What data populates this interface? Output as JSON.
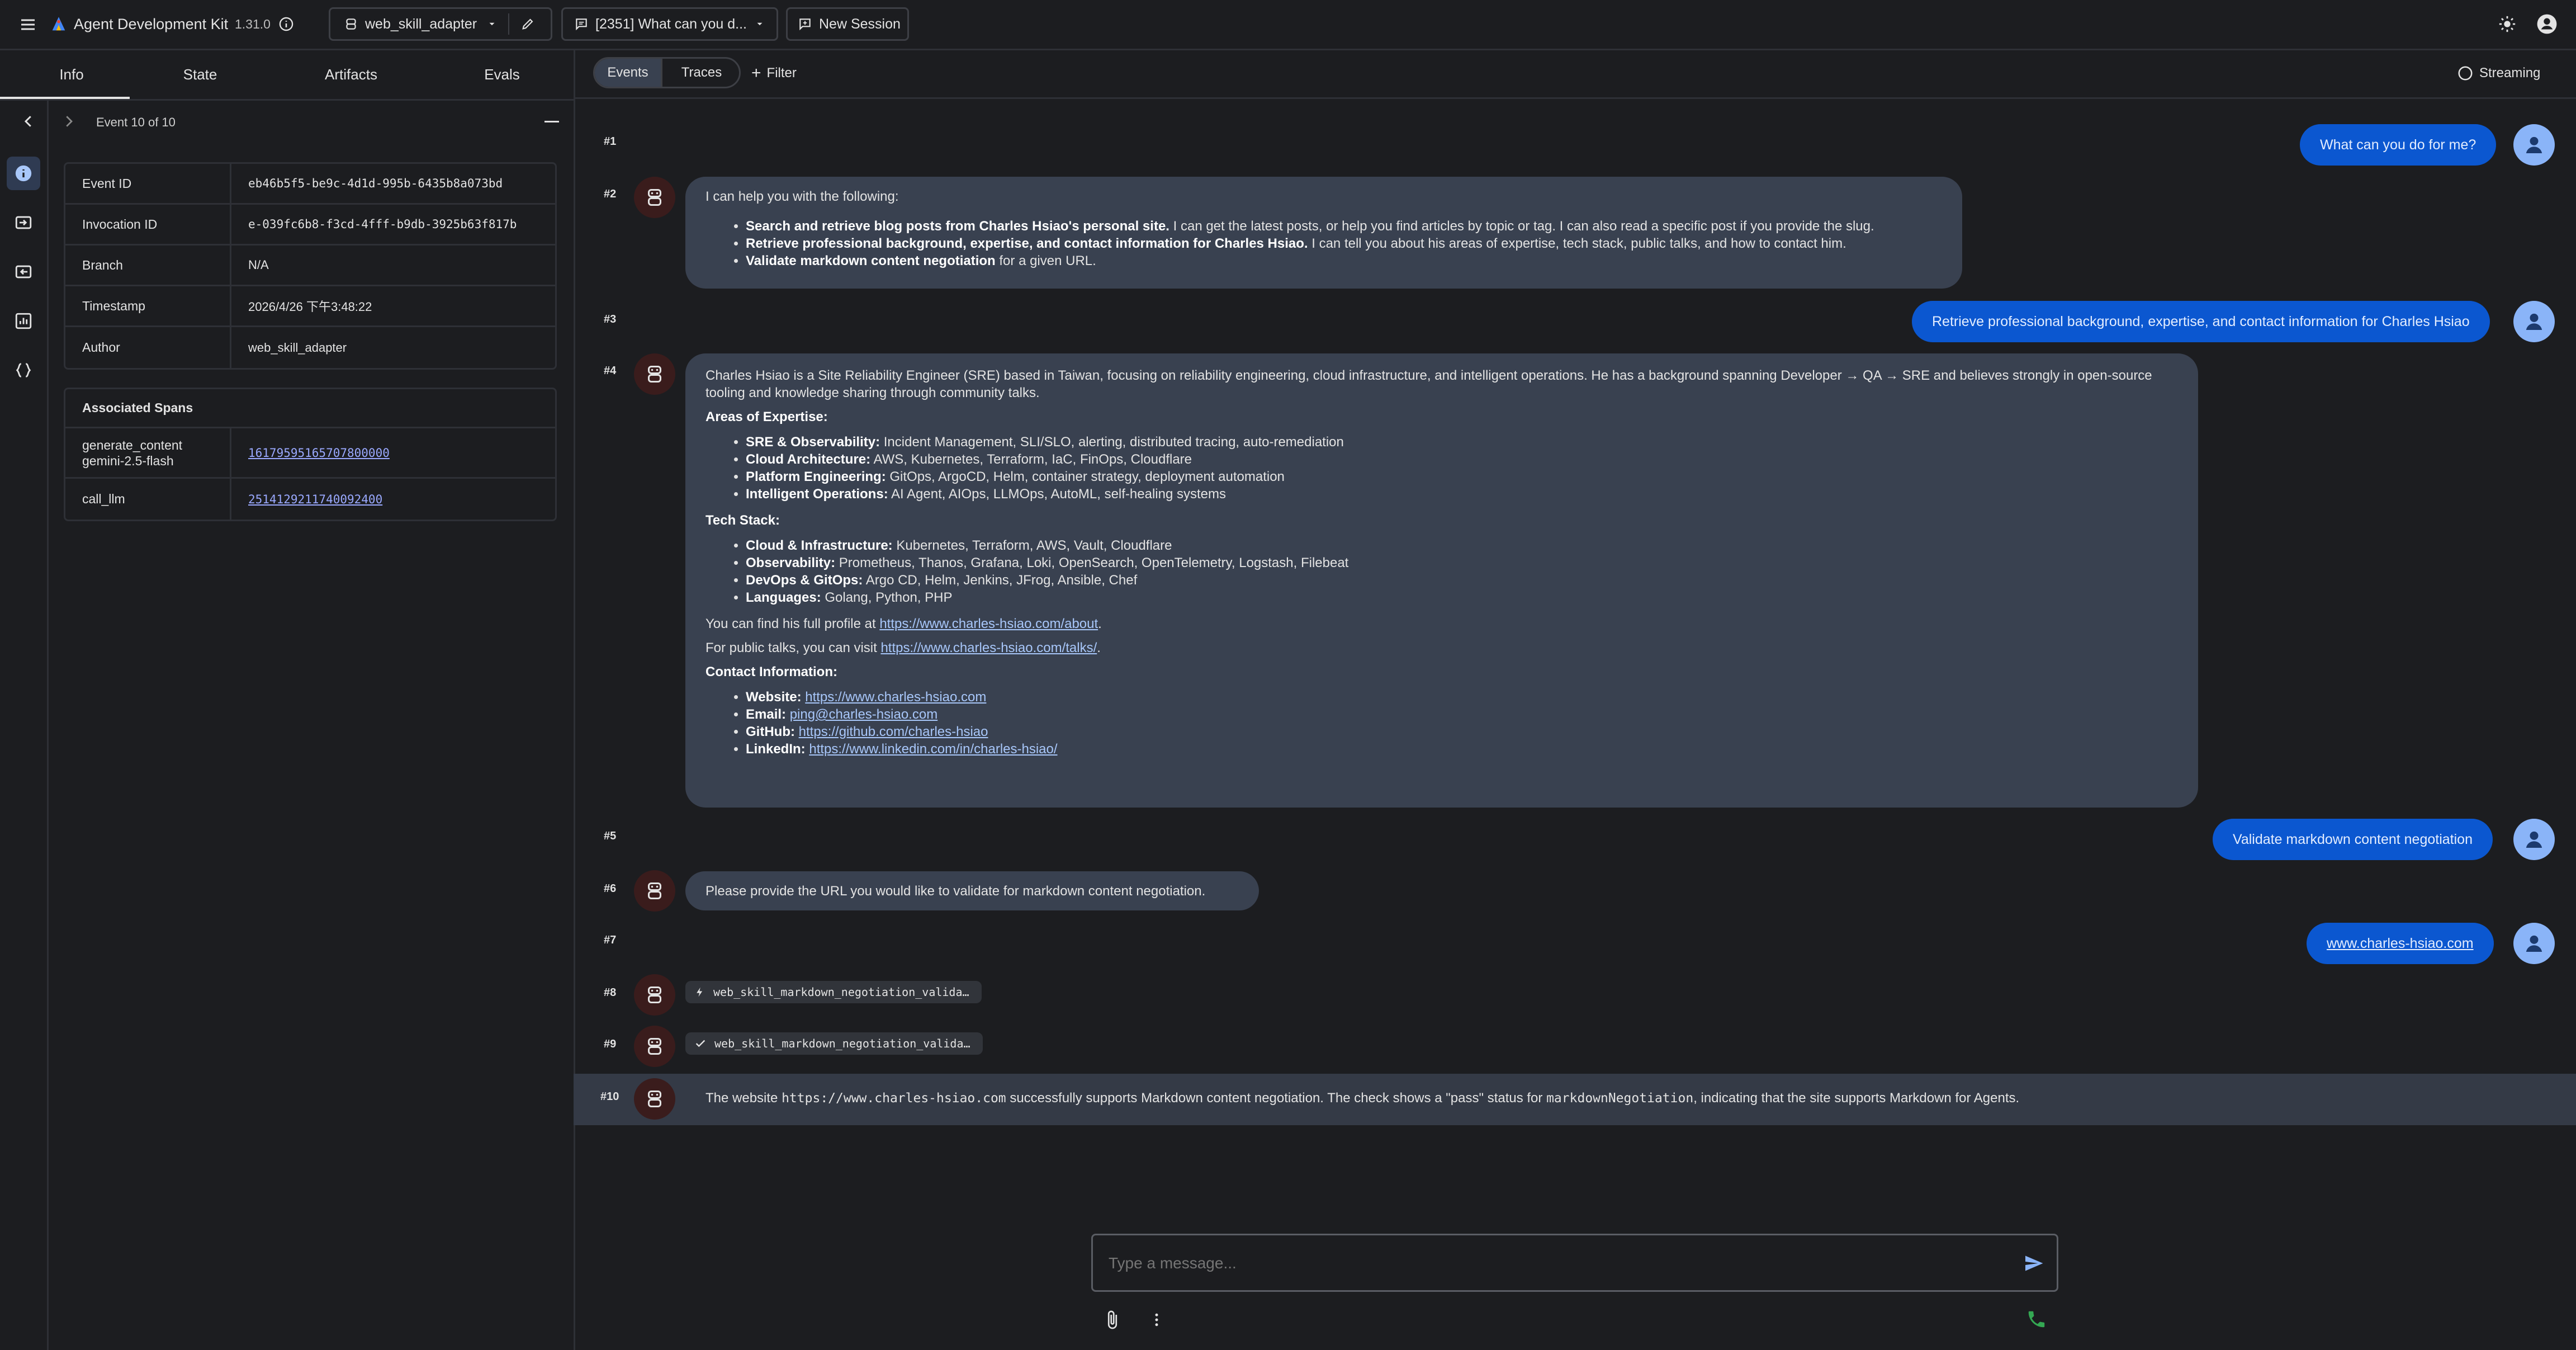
{
  "app": {
    "title": "Agent Development Kit",
    "version": "1.31.0"
  },
  "topbar": {
    "agent": "web_skill_adapter",
    "session": "[2351] What can you d...",
    "new_session": "New Session"
  },
  "left": {
    "tabs": [
      "Info",
      "State",
      "Artifacts",
      "Evals"
    ],
    "event_nav": "Event 10 of 10",
    "details": [
      {
        "k": "Event ID",
        "v": "eb46b5f5-be9c-4d1d-995b-6435b8a073bd"
      },
      {
        "k": "Invocation ID",
        "v": "e-039fc6b8-f3cd-4fff-b9db-3925b63f817b"
      },
      {
        "k": "Branch",
        "v": "N/A"
      },
      {
        "k": "Timestamp",
        "v": "2026/4/26 下午3:48:22"
      },
      {
        "k": "Author",
        "v": "web_skill_adapter"
      }
    ],
    "spans_title": "Associated Spans",
    "spans": [
      {
        "k1": "generate_content",
        "k2": "gemini-2.5-flash",
        "v": "16179595165707800000"
      },
      {
        "k": "call_llm",
        "v": "2514129211740092400"
      }
    ]
  },
  "main": {
    "toggle": [
      "Events",
      "Traces"
    ],
    "filter": "Filter",
    "streaming": "Streaming",
    "nums": [
      "#1",
      "#2",
      "#3",
      "#4",
      "#5",
      "#6",
      "#7",
      "#8",
      "#9",
      "#10"
    ],
    "msg1": "What can you do for me?",
    "msg2": {
      "intro": "I can help you with the following:",
      "items": [
        {
          "b": "Search and retrieve blog posts from Charles Hsiao's personal site.",
          "t": " I can get the latest posts, or help you find articles by topic or tag. I can also read a specific post if you provide the slug."
        },
        {
          "b": "Retrieve professional background, expertise, and contact information for Charles Hsiao.",
          "t": " I can tell you about his areas of expertise, tech stack, public talks, and how to contact him."
        },
        {
          "b": "Validate markdown content negotiation",
          "t": " for a given URL."
        }
      ]
    },
    "msg3": "Retrieve professional background, expertise, and contact information for Charles Hsiao",
    "msg4": {
      "intro": "Charles Hsiao is a Site Reliability Engineer (SRE) based in Taiwan, focusing on reliability engineering, cloud infrastructure, and intelligent operations. He has a background spanning Developer → QA → SRE and believes strongly in open-source tooling and knowledge sharing through community talks.",
      "h1": "Areas of Expertise:",
      "exp": [
        {
          "b": "SRE & Observability:",
          "t": " Incident Management, SLI/SLO, alerting, distributed tracing, auto-remediation"
        },
        {
          "b": "Cloud Architecture:",
          "t": " AWS, Kubernetes, Terraform, IaC, FinOps, Cloudflare"
        },
        {
          "b": "Platform Engineering:",
          "t": " GitOps, ArgoCD, Helm, container strategy, deployment automation"
        },
        {
          "b": "Intelligent Operations:",
          "t": " AI Agent, AIOps, LLMOps, AutoML, self-healing systems"
        }
      ],
      "h2": "Tech Stack:",
      "tech": [
        {
          "b": "Cloud & Infrastructure:",
          "t": " Kubernetes, Terraform, AWS, Vault, Cloudflare"
        },
        {
          "b": "Observability:",
          "t": " Prometheus, Thanos, Grafana, Loki, OpenSearch, OpenTelemetry, Logstash, Filebeat"
        },
        {
          "b": "DevOps & GitOps:",
          "t": " Argo CD, Helm, Jenkins, JFrog, Ansible, Chef"
        },
        {
          "b": "Languages:",
          "t": " Golang, Python, PHP"
        }
      ],
      "profile_pre": "You can find his full profile at ",
      "profile_link": "https://www.charles-hsiao.com/about",
      "talks_pre": "For public talks, you can visit ",
      "talks_link": "https://www.charles-hsiao.com/talks/",
      "h3": "Contact Information:",
      "contact": [
        {
          "b": "Website:",
          "v": "https://www.charles-hsiao.com"
        },
        {
          "b": "Email:",
          "v": "ping@charles-hsiao.com"
        },
        {
          "b": "GitHub:",
          "v": "https://github.com/charles-hsiao"
        },
        {
          "b": "LinkedIn:",
          "v": "https://www.linkedin.com/in/charles-hsiao/"
        }
      ]
    },
    "msg5": "Validate markdown content negotiation",
    "msg6": "Please provide the URL you would like to validate for markdown content negotiation.",
    "msg7": "www.charles-hsiao.com",
    "msg8": "web_skill_markdown_negotiation_valida…",
    "msg9": "web_skill_markdown_negotiation_valida…",
    "msg10": {
      "a": "The website ",
      "code1": "https://www.charles-hsiao.com",
      "b": " successfully supports Markdown content negotiation. The check shows a \"pass\" status for ",
      "code2": "markdownNegotiation",
      "c": ", indicating that the site supports Markdown for Agents."
    },
    "input_placeholder": "Type a message..."
  },
  "colors": {
    "user_bubble": "#0b57d0",
    "agent_bubble": "#394150",
    "accent": "#8ab4f8",
    "call_green": "#34a853"
  }
}
